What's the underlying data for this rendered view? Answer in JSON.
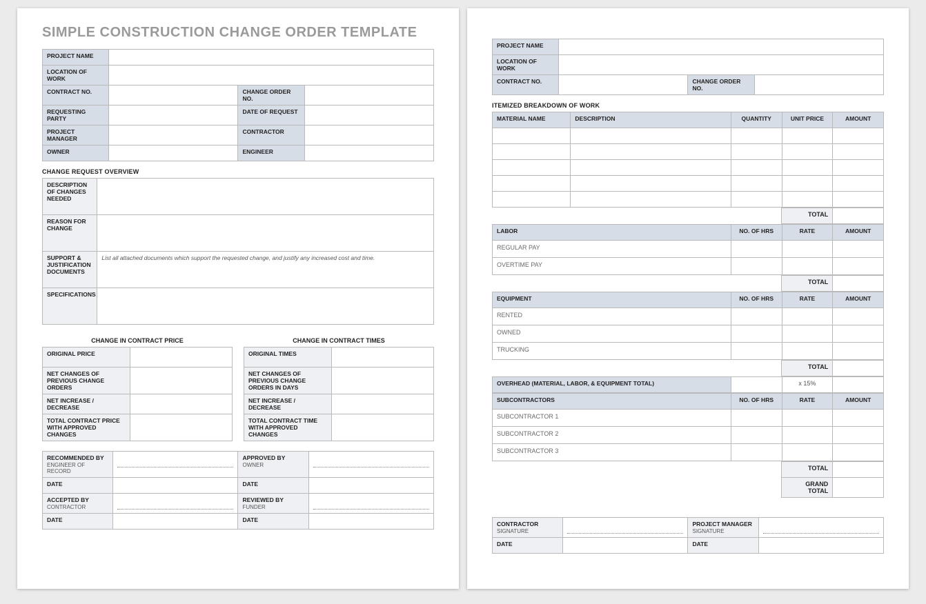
{
  "title": "SIMPLE CONSTRUCTION CHANGE ORDER TEMPLATE",
  "header": {
    "project_name": "PROJECT NAME",
    "location_of_work": "LOCATION OF WORK",
    "contract_no": "CONTRACT NO.",
    "change_order_no": "CHANGE ORDER NO.",
    "requesting_party": "REQUESTING PARTY",
    "date_of_request": "DATE OF REQUEST",
    "project_manager": "PROJECT MANAGER",
    "contractor": "CONTRACTOR",
    "owner": "OWNER",
    "engineer": "ENGINEER"
  },
  "overview": {
    "section": "CHANGE REQUEST OVERVIEW",
    "desc": "DESCRIPTION OF CHANGES NEEDED",
    "reason": "REASON FOR CHANGE",
    "support": "SUPPORT & JUSTIFICATION DOCUMENTS",
    "support_hint": "List all attached documents which support the requested change, and justify any increased cost and time.",
    "specs": "SPECIFICATIONS"
  },
  "change_price": {
    "head": "CHANGE IN CONTRACT PRICE",
    "r1": "ORIGINAL PRICE",
    "r2": "NET CHANGES OF PREVIOUS CHANGE ORDERS",
    "r3": "NET INCREASE / DECREASE",
    "r4": "TOTAL CONTRACT PRICE WITH APPROVED CHANGES"
  },
  "change_times": {
    "head": "CHANGE IN CONTRACT TIMES",
    "r1": "ORIGINAL TIMES",
    "r2": "NET CHANGES OF PREVIOUS CHANGE ORDERS IN DAYS",
    "r3": "NET INCREASE / DECREASE",
    "r4": "TOTAL CONTRACT TIME WITH APPROVED CHANGES"
  },
  "sig1": {
    "recommended": "RECOMMENDED BY",
    "recommended_sub": "ENGINEER OF RECORD",
    "approved": "APPROVED BY",
    "approved_sub": "OWNER",
    "accepted": "ACCEPTED BY",
    "accepted_sub": "CONTRACTOR",
    "reviewed": "REVIEWED BY",
    "reviewed_sub": "FUNDER",
    "date": "DATE"
  },
  "page2": {
    "itemized": "ITEMIZED BREAKDOWN OF WORK",
    "cols": {
      "material": "MATERIAL NAME",
      "desc": "DESCRIPTION",
      "qty": "QUANTITY",
      "unit": "UNIT PRICE",
      "amount": "AMOUNT"
    },
    "labor": "LABOR",
    "no_hrs": "NO. OF HRS",
    "rate": "RATE",
    "amount": "AMOUNT",
    "regular_pay": "REGULAR PAY",
    "overtime_pay": "OVERTIME PAY",
    "equipment": "EQUIPMENT",
    "rented": "RENTED",
    "owned": "OWNED",
    "trucking": "TRUCKING",
    "overhead": "OVERHEAD (MATERIAL, LABOR, & EQUIPMENT TOTAL)",
    "overhead_pct": "x 15%",
    "subcontractors": "SUBCONTRACTORS",
    "sub1": "SUBCONTRACTOR 1",
    "sub2": "SUBCONTRACTOR 2",
    "sub3": "SUBCONTRACTOR 3",
    "total": "TOTAL",
    "grand_total": "GRAND TOTAL"
  },
  "sig2": {
    "contractor": "CONTRACTOR",
    "pm": "PROJECT MANAGER",
    "signature": "SIGNATURE",
    "date": "DATE"
  }
}
